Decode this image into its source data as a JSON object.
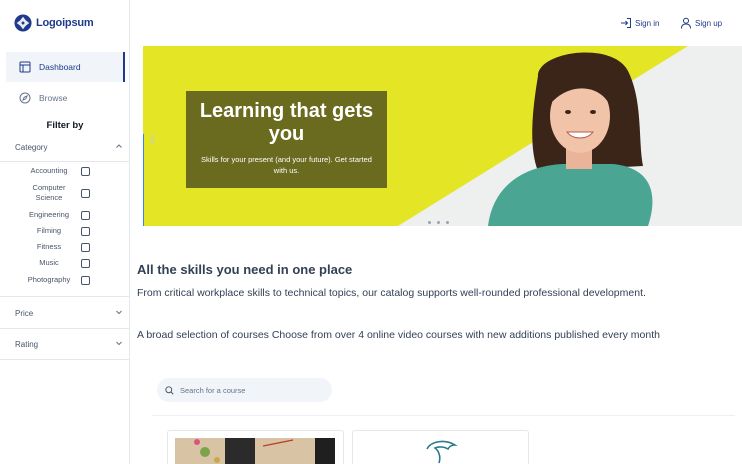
{
  "brand": {
    "name": "Logoipsum",
    "color": "#1e3a8a"
  },
  "sidebar": {
    "nav": [
      {
        "label": "Dashboard",
        "icon": "dashboard-icon",
        "active": true
      },
      {
        "label": "Browse",
        "icon": "compass-icon",
        "active": false
      }
    ],
    "filter_title": "Filter by",
    "filters": {
      "category": {
        "label": "Category",
        "expanded": true,
        "options": [
          "Accounting",
          "Computer Science",
          "Engineering",
          "Filming",
          "Fitness",
          "Music",
          "Photography"
        ]
      },
      "price": {
        "label": "Price",
        "expanded": false
      },
      "rating": {
        "label": "Rating",
        "expanded": false
      }
    }
  },
  "header": {
    "sign_in": "Sign in",
    "sign_up": "Sign up"
  },
  "hero": {
    "title": "Learning that gets you",
    "subtitle": "Skills for your present (and your future). Get started with us.",
    "colors": {
      "yellow": "#e4e524",
      "card": "#6b6b1f",
      "sweater": "#4aa593"
    },
    "slide_count": 3
  },
  "main": {
    "heading": "All the skills you need in one place",
    "paragraph1": "From critical workplace skills to technical topics, our catalog supports well-rounded professional development.",
    "paragraph2": "A broad selection of courses Choose from over 4 online video courses with new additions published every month",
    "search_placeholder": "Search for a course"
  }
}
